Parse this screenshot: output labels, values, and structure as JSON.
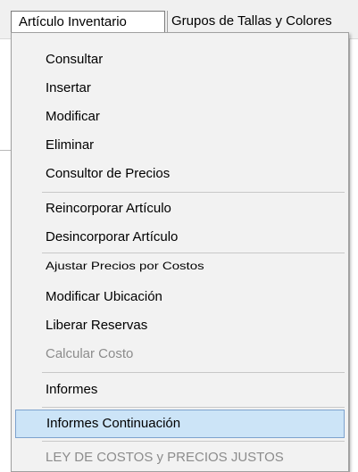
{
  "menubar": {
    "active": "Artículo Inventario",
    "next": "Grupos de Tallas y Colores"
  },
  "menu": {
    "items": [
      {
        "label": "Consultar",
        "disabled": false
      },
      {
        "label": "Insertar",
        "disabled": false
      },
      {
        "label": "Modificar",
        "disabled": false
      },
      {
        "label": "Eliminar",
        "disabled": false
      },
      {
        "label": "Consultor de Precios",
        "disabled": false
      },
      {
        "label": "Reincorporar Artículo",
        "disabled": false
      },
      {
        "label": "Desincorporar Artículo",
        "disabled": false
      },
      {
        "label": "Ajustar Precios por Costos",
        "disabled": false
      },
      {
        "label": "Modificar Ubicación",
        "disabled": false
      },
      {
        "label": "Liberar Reservas",
        "disabled": false
      },
      {
        "label": "Calcular Costo",
        "disabled": true
      },
      {
        "label": "Informes",
        "disabled": false
      },
      {
        "label": "Informes Continuación",
        "disabled": false,
        "highlighted": true
      },
      {
        "label": "LEY DE COSTOS y PRECIOS JUSTOS",
        "disabled": true
      }
    ]
  },
  "colors": {
    "menu_background": "#f2f2f2",
    "highlight_background": "#cce4f7",
    "highlight_border": "#7da2ce",
    "disabled_text": "#8c8c8c"
  }
}
